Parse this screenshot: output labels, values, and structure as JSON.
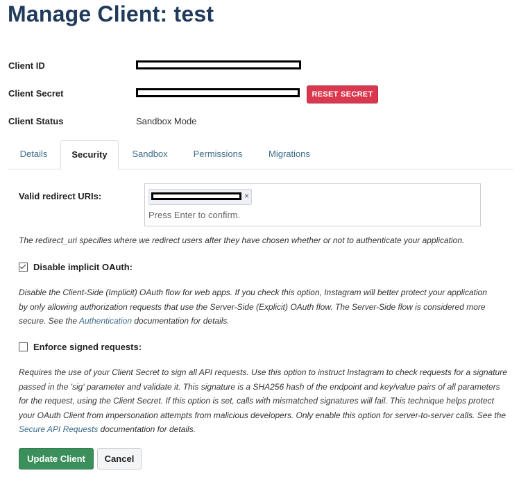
{
  "page": {
    "title": "Manage Client: test"
  },
  "client_info": {
    "id_label": "Client ID",
    "secret_label": "Client Secret",
    "status_label": "Client Status",
    "status_value": "Sandbox Mode",
    "reset_secret_label": "RESET SECRET"
  },
  "tabs": [
    {
      "label": "Details",
      "active": false
    },
    {
      "label": "Security",
      "active": true
    },
    {
      "label": "Sandbox",
      "active": false
    },
    {
      "label": "Permissions",
      "active": false
    },
    {
      "label": "Migrations",
      "active": false
    }
  ],
  "security": {
    "redirect_label": "Valid redirect URIs:",
    "redirect_tag_remove": "×",
    "redirect_placeholder": "Press Enter to confirm.",
    "redirect_help": "The redirect_uri specifies where we redirect users after they have chosen whether or not to authenticate your application.",
    "implicit": {
      "label": "Disable implicit OAuth:",
      "checked": true,
      "help_before": "Disable the Client-Side (Implicit) OAuth flow for web apps. If you check this option, Instagram will better protect your application by only allowing authorization requests that use the Server-Side (Explicit) OAuth flow. The Server-Side flow is considered more secure. See the ",
      "help_link": "Authentication",
      "help_after": " documentation for details."
    },
    "signed": {
      "label": "Enforce signed requests:",
      "checked": false,
      "help_before": "Requires the use of your Client Secret to sign all API requests. Use this option to instruct Instagram to check requests for a signature passed in the 'sig' parameter and validate it. This signature is a SHA256 hash of the endpoint and key/value pairs of all parameters for the request, using the Client Secret. If this option is set, calls with mismatched signatures will fail. This technique helps protect your OAuth Client from impersonation attempts from malicious developers. Only enable this option for server-to-server calls. See the ",
      "help_link": "Secure API Requests",
      "help_after": " documentation for details."
    }
  },
  "actions": {
    "update_label": "Update Client",
    "cancel_label": "Cancel"
  },
  "colors": {
    "title": "#1f3a5a",
    "link": "#3d6b8c",
    "reset_button": "#d9384f",
    "update_button": "#3a8f5a"
  }
}
